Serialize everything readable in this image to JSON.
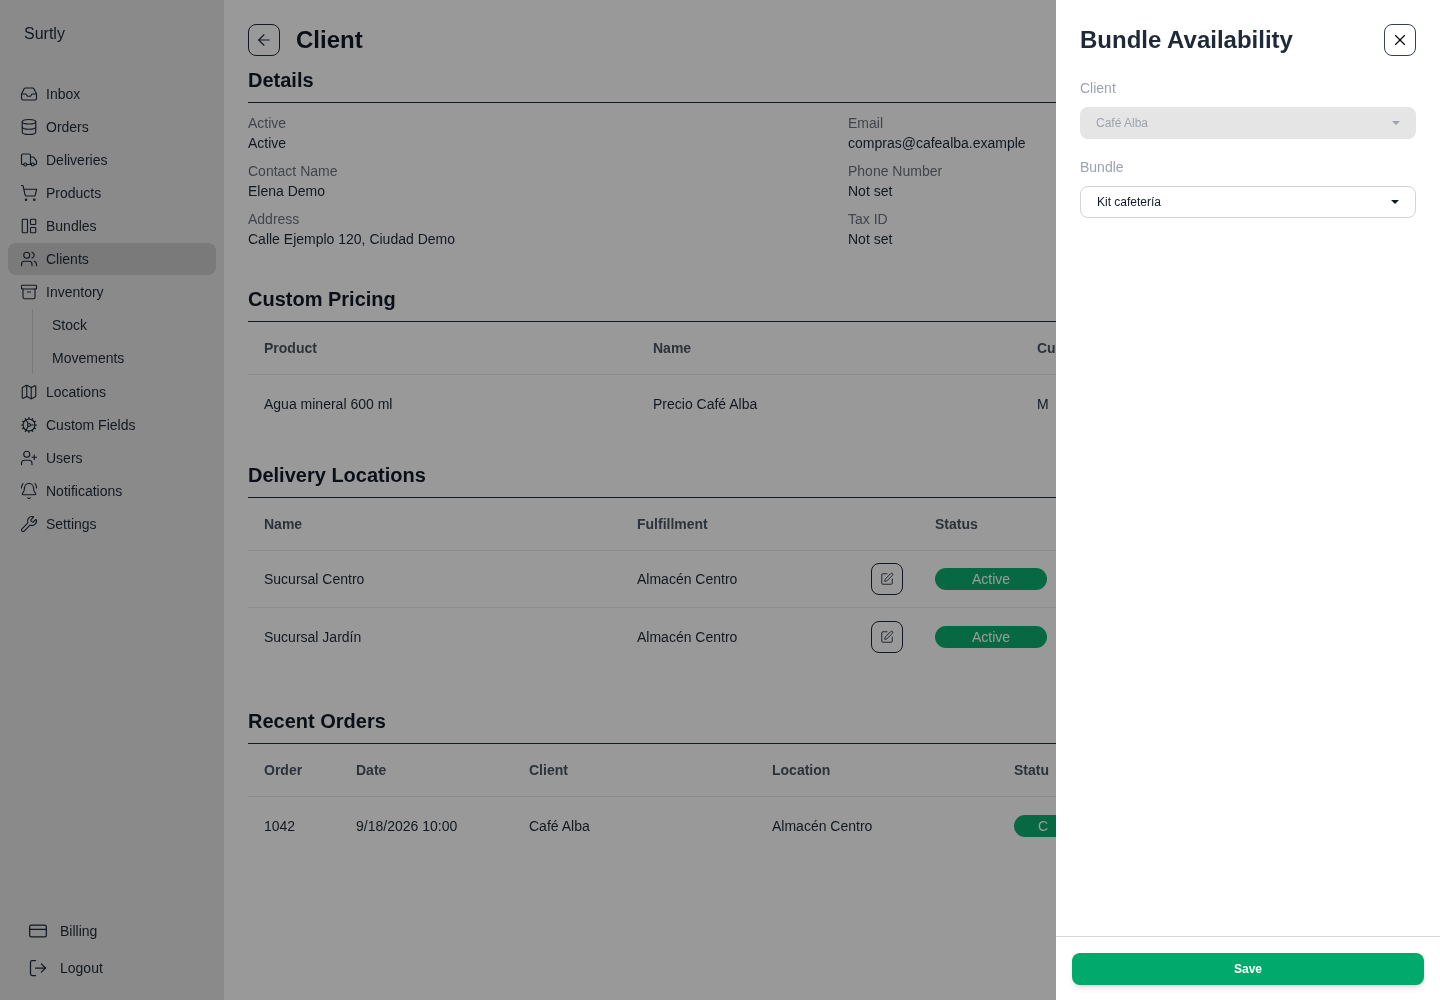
{
  "app_name": "Surtly",
  "sidebar": {
    "items": [
      {
        "label": "Inbox",
        "selected": false
      },
      {
        "label": "Orders",
        "selected": false
      },
      {
        "label": "Deliveries",
        "selected": false
      },
      {
        "label": "Products",
        "selected": false
      },
      {
        "label": "Bundles",
        "selected": false
      },
      {
        "label": "Clients",
        "selected": true
      },
      {
        "label": "Inventory",
        "selected": false,
        "children": [
          {
            "label": "Stock",
            "selected": false
          },
          {
            "label": "Movements",
            "selected": false
          }
        ]
      },
      {
        "label": "Locations",
        "selected": false
      },
      {
        "label": "Custom Fields",
        "selected": false
      },
      {
        "label": "Users",
        "selected": false
      },
      {
        "label": "Notifications",
        "selected": false
      },
      {
        "label": "Settings",
        "selected": false
      }
    ],
    "footer_items": [
      {
        "label": "Billing"
      },
      {
        "label": "Logout"
      }
    ]
  },
  "page": {
    "title": "Client"
  },
  "details": {
    "title": "Details",
    "fields": [
      {
        "label": "Active",
        "value": "Active"
      },
      {
        "label": "Email",
        "value": "compras@cafealba.example"
      },
      {
        "label": "Contact Name",
        "value": "Elena Demo"
      },
      {
        "label": "Phone Number",
        "value": "Not set"
      },
      {
        "label": "Address",
        "value": "Calle Ejemplo 120, Ciudad Demo"
      },
      {
        "label": "Tax ID",
        "value": "Not set"
      }
    ]
  },
  "custom_pricing": {
    "title": "Custom Pricing",
    "columns": [
      "Product",
      "Name",
      "Cu"
    ],
    "rows": [
      [
        "Agua mineral 600 ml",
        "Precio Café Alba",
        "M"
      ]
    ]
  },
  "delivery_locations": {
    "title": "Delivery Locations",
    "columns": [
      "Name",
      "Fulfillment",
      "Status"
    ],
    "rows": [
      {
        "name": "Sucursal Centro",
        "fulfillment": "Almacén Centro",
        "status": "Active"
      },
      {
        "name": "Sucursal Jardín",
        "fulfillment": "Almacén Centro",
        "status": "Active"
      }
    ]
  },
  "recent_orders": {
    "title": "Recent Orders",
    "columns": [
      "Order",
      "Date",
      "Client",
      "Location",
      "Statu"
    ],
    "rows": [
      {
        "order": "1042",
        "date": "9/18/2026 10:00",
        "client": "Café Alba",
        "location": "Almacén Centro",
        "status": "C"
      }
    ]
  },
  "drawer": {
    "title": "Bundle Availability",
    "fields": [
      {
        "label": "Client",
        "value": "Café Alba",
        "disabled": true
      },
      {
        "label": "Bundle",
        "value": "Kit cafetería",
        "disabled": false
      }
    ],
    "save_label": "Save"
  }
}
